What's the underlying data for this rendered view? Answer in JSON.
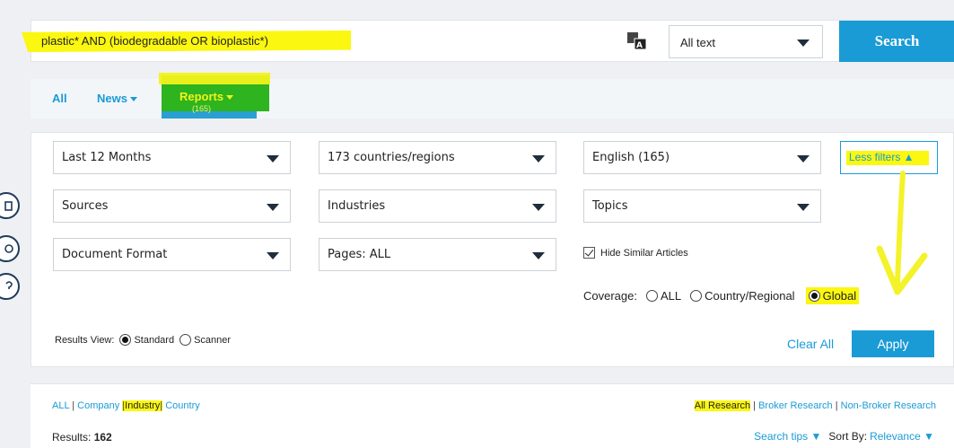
{
  "search": {
    "query": "plastic* AND (biodegradable OR bioplastic*)",
    "scope_label": "All text",
    "button_label": "Search"
  },
  "tabs": {
    "all": "All",
    "news": "News",
    "reports": "Reports",
    "reports_count": "(165)"
  },
  "filters": {
    "date": "Last 12 Months",
    "regions": "173 countries/regions",
    "language": "English (165)",
    "less_filters": "Less filters ▲",
    "sources": "Sources",
    "industries": "Industries",
    "topics": "Topics",
    "doc_format": "Document Format",
    "pages": "Pages: ALL",
    "hide_similar": "Hide Similar Articles",
    "coverage_label": "Coverage:",
    "coverage_all": "ALL",
    "coverage_country": "Country/Regional",
    "coverage_global": "Global",
    "results_view_label": "Results View:",
    "view_standard": "Standard",
    "view_scanner": "Scanner",
    "clear_all": "Clear All",
    "apply": "Apply"
  },
  "results": {
    "tab_all": "ALL",
    "tab_company": "Company",
    "tab_industry": "Industry",
    "tab_country": "Country",
    "all_research": "All Research",
    "broker_research": "Broker Research",
    "non_broker_research": "Non-Broker Research",
    "results_label": "Results:",
    "results_value": "162",
    "search_tips": "Search tips ▼",
    "sort_by_label": "Sort By:",
    "sort_by_value": "Relevance ▼"
  },
  "colors": {
    "accent": "#1a9bd6",
    "highlight_yellow": "#fbf710",
    "highlight_green": "#2eb41f"
  }
}
